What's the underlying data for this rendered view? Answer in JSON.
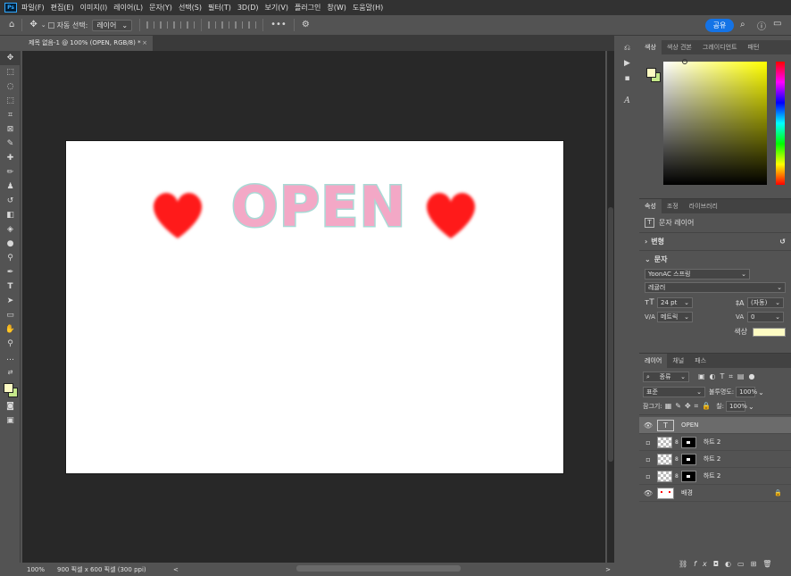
{
  "app": {
    "logo": "Ps"
  },
  "menu": [
    "파일(F)",
    "편집(E)",
    "이미지(I)",
    "레이어(L)",
    "문자(Y)",
    "선택(S)",
    "필터(T)",
    "3D(D)",
    "보기(V)",
    "플러그인",
    "창(W)",
    "도움말(H)"
  ],
  "options": {
    "auto_select_label": "자동 선택:",
    "auto_select_value": "레이어",
    "more": "•••",
    "share": "공유"
  },
  "document": {
    "tab_title": "제목 없음-1 @ 100% (OPEN, RGB/8) *",
    "close": "×"
  },
  "canvas": {
    "text": "OPEN",
    "heart_color": "#ff1a1a",
    "text_fill": "#f3a8c6",
    "text_stroke": "#a9d9d5"
  },
  "status": {
    "zoom": "100%",
    "doc_info": "900 픽셀 x 600 픽셀 (300 ppi)",
    "arrow": "<",
    "right_arrow": ">"
  },
  "color_panel": {
    "tabs": [
      "색상",
      "색상 견본",
      "그레이디언트",
      "패턴"
    ]
  },
  "properties_panel": {
    "tabs": [
      "속성",
      "조정",
      "라이브러리"
    ],
    "layer_type": "문자 레이어",
    "section_transform": "변형",
    "section_character": "문자",
    "font_family": "YoonAC 스프링",
    "font_style": "레귤러",
    "font_size": "24 pt",
    "leading": "(자동)",
    "kerning": "메트릭",
    "tracking": "0",
    "color_label": "색상",
    "color_value": "#fdfbc3"
  },
  "layers_panel": {
    "tabs": [
      "레이어",
      "채널",
      "패스"
    ],
    "filter": "종류",
    "blend_mode": "표준",
    "opacity_label": "불투명도:",
    "opacity": "100%",
    "lock_label": "잠그기:",
    "fill_label": "칠:",
    "fill": "100%",
    "layers": [
      {
        "name": "OPEN",
        "visible": true,
        "kind": "text"
      },
      {
        "name": "하트 2",
        "visible": false,
        "kind": "masked"
      },
      {
        "name": "하트 2",
        "visible": false,
        "kind": "masked"
      },
      {
        "name": "하트 2",
        "visible": false,
        "kind": "masked"
      },
      {
        "name": "배경",
        "visible": true,
        "kind": "background"
      }
    ]
  },
  "colors": {
    "foreground": "#fdfbc3",
    "background": "#c5e88a",
    "accent": "#1473e6"
  }
}
